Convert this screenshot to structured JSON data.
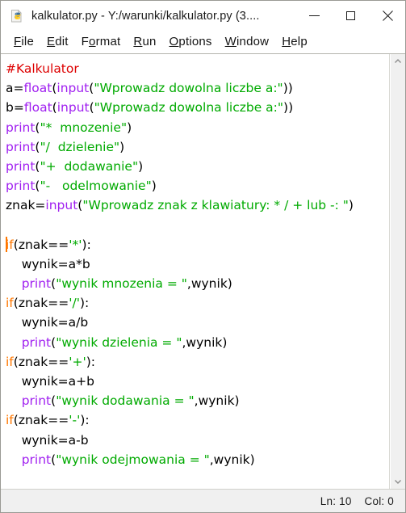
{
  "window": {
    "title": "kalkulator.py - Y:/warunki/kalkulator.py (3....",
    "icon": "python-file-icon",
    "controls": {
      "minimize_label": "Minimize",
      "maximize_label": "Maximize",
      "close_label": "Close"
    }
  },
  "menubar": {
    "items": [
      {
        "label": "File",
        "pre": "",
        "mnemonic": "F",
        "post": "ile"
      },
      {
        "label": "Edit",
        "pre": "",
        "mnemonic": "E",
        "post": "dit"
      },
      {
        "label": "Format",
        "pre": "F",
        "mnemonic": "o",
        "post": "rmat"
      },
      {
        "label": "Run",
        "pre": "",
        "mnemonic": "R",
        "post": "un"
      },
      {
        "label": "Options",
        "pre": "",
        "mnemonic": "O",
        "post": "ptions"
      },
      {
        "label": "Window",
        "pre": "",
        "mnemonic": "W",
        "post": "indow"
      },
      {
        "label": "Help",
        "pre": "",
        "mnemonic": "H",
        "post": "elp"
      }
    ]
  },
  "colors": {
    "comment": "#dd0000",
    "builtin": "#a020f0",
    "string": "#00aa00",
    "keyword": "#ff7700",
    "plain": "#000000",
    "background": "#ffffff",
    "chrome": "#f0f0f0"
  },
  "editor": {
    "language": "python",
    "caret_line": 10,
    "caret_col": 0,
    "lines": [
      {
        "n": 1,
        "tokens": [
          {
            "t": "comment",
            "v": "#Kalkulator"
          }
        ]
      },
      {
        "n": 2,
        "tokens": [
          {
            "t": "plain",
            "v": "a="
          },
          {
            "t": "builtin",
            "v": "float"
          },
          {
            "t": "plain",
            "v": "("
          },
          {
            "t": "builtin",
            "v": "input"
          },
          {
            "t": "plain",
            "v": "("
          },
          {
            "t": "string",
            "v": "\"Wprowadz dowolna liczbe a:\""
          },
          {
            "t": "plain",
            "v": "))"
          }
        ]
      },
      {
        "n": 3,
        "tokens": [
          {
            "t": "plain",
            "v": "b="
          },
          {
            "t": "builtin",
            "v": "float"
          },
          {
            "t": "plain",
            "v": "("
          },
          {
            "t": "builtin",
            "v": "input"
          },
          {
            "t": "plain",
            "v": "("
          },
          {
            "t": "string",
            "v": "\"Wprowadz dowolna liczbe a:\""
          },
          {
            "t": "plain",
            "v": "))"
          }
        ]
      },
      {
        "n": 4,
        "tokens": [
          {
            "t": "builtin",
            "v": "print"
          },
          {
            "t": "plain",
            "v": "("
          },
          {
            "t": "string",
            "v": "\"*  mnozenie\""
          },
          {
            "t": "plain",
            "v": ")"
          }
        ]
      },
      {
        "n": 5,
        "tokens": [
          {
            "t": "builtin",
            "v": "print"
          },
          {
            "t": "plain",
            "v": "("
          },
          {
            "t": "string",
            "v": "\"/  dzielenie\""
          },
          {
            "t": "plain",
            "v": ")"
          }
        ]
      },
      {
        "n": 6,
        "tokens": [
          {
            "t": "builtin",
            "v": "print"
          },
          {
            "t": "plain",
            "v": "("
          },
          {
            "t": "string",
            "v": "\"+  dodawanie\""
          },
          {
            "t": "plain",
            "v": ")"
          }
        ]
      },
      {
        "n": 7,
        "tokens": [
          {
            "t": "builtin",
            "v": "print"
          },
          {
            "t": "plain",
            "v": "("
          },
          {
            "t": "string",
            "v": "\"-   odelmowanie\""
          },
          {
            "t": "plain",
            "v": ")"
          }
        ]
      },
      {
        "n": 8,
        "tokens": [
          {
            "t": "plain",
            "v": "znak="
          },
          {
            "t": "builtin",
            "v": "input"
          },
          {
            "t": "plain",
            "v": "("
          },
          {
            "t": "string",
            "v": "\"Wprowadz znak z klawiatury: * / + lub -: \""
          },
          {
            "t": "plain",
            "v": ")"
          }
        ]
      },
      {
        "n": 9,
        "tokens": []
      },
      {
        "n": 10,
        "caret": true,
        "tokens": [
          {
            "t": "keyword",
            "v": "if"
          },
          {
            "t": "plain",
            "v": "(znak=="
          },
          {
            "t": "string",
            "v": "'*'"
          },
          {
            "t": "plain",
            "v": "):"
          }
        ]
      },
      {
        "n": 11,
        "tokens": [
          {
            "t": "plain",
            "v": "    wynik=a*b"
          }
        ]
      },
      {
        "n": 12,
        "tokens": [
          {
            "t": "plain",
            "v": "    "
          },
          {
            "t": "builtin",
            "v": "print"
          },
          {
            "t": "plain",
            "v": "("
          },
          {
            "t": "string",
            "v": "\"wynik mnozenia = \""
          },
          {
            "t": "plain",
            "v": ",wynik)"
          }
        ]
      },
      {
        "n": 13,
        "tokens": [
          {
            "t": "keyword",
            "v": "if"
          },
          {
            "t": "plain",
            "v": "(znak=="
          },
          {
            "t": "string",
            "v": "'/'"
          },
          {
            "t": "plain",
            "v": "):"
          }
        ]
      },
      {
        "n": 14,
        "tokens": [
          {
            "t": "plain",
            "v": "    wynik=a/b"
          }
        ]
      },
      {
        "n": 15,
        "tokens": [
          {
            "t": "plain",
            "v": "    "
          },
          {
            "t": "builtin",
            "v": "print"
          },
          {
            "t": "plain",
            "v": "("
          },
          {
            "t": "string",
            "v": "\"wynik dzielenia = \""
          },
          {
            "t": "plain",
            "v": ",wynik)"
          }
        ]
      },
      {
        "n": 16,
        "tokens": [
          {
            "t": "keyword",
            "v": "if"
          },
          {
            "t": "plain",
            "v": "(znak=="
          },
          {
            "t": "string",
            "v": "'+'"
          },
          {
            "t": "plain",
            "v": "):"
          }
        ]
      },
      {
        "n": 17,
        "tokens": [
          {
            "t": "plain",
            "v": "    wynik=a+b"
          }
        ]
      },
      {
        "n": 18,
        "tokens": [
          {
            "t": "plain",
            "v": "    "
          },
          {
            "t": "builtin",
            "v": "print"
          },
          {
            "t": "plain",
            "v": "("
          },
          {
            "t": "string",
            "v": "\"wynik dodawania = \""
          },
          {
            "t": "plain",
            "v": ",wynik)"
          }
        ]
      },
      {
        "n": 19,
        "tokens": [
          {
            "t": "keyword",
            "v": "if"
          },
          {
            "t": "plain",
            "v": "(znak=="
          },
          {
            "t": "string",
            "v": "'-'"
          },
          {
            "t": "plain",
            "v": "):"
          }
        ]
      },
      {
        "n": 20,
        "tokens": [
          {
            "t": "plain",
            "v": "    wynik=a-b"
          }
        ]
      },
      {
        "n": 21,
        "tokens": [
          {
            "t": "plain",
            "v": "    "
          },
          {
            "t": "builtin",
            "v": "print"
          },
          {
            "t": "plain",
            "v": "("
          },
          {
            "t": "string",
            "v": "\"wynik odejmowania = \""
          },
          {
            "t": "plain",
            "v": ",wynik)"
          }
        ]
      }
    ]
  },
  "scrollbar": {
    "up_arrow_icon": "chevron-up-icon",
    "down_arrow_icon": "chevron-down-icon"
  },
  "statusbar": {
    "line_label": "Ln: 10",
    "col_label": "Col: 0"
  }
}
